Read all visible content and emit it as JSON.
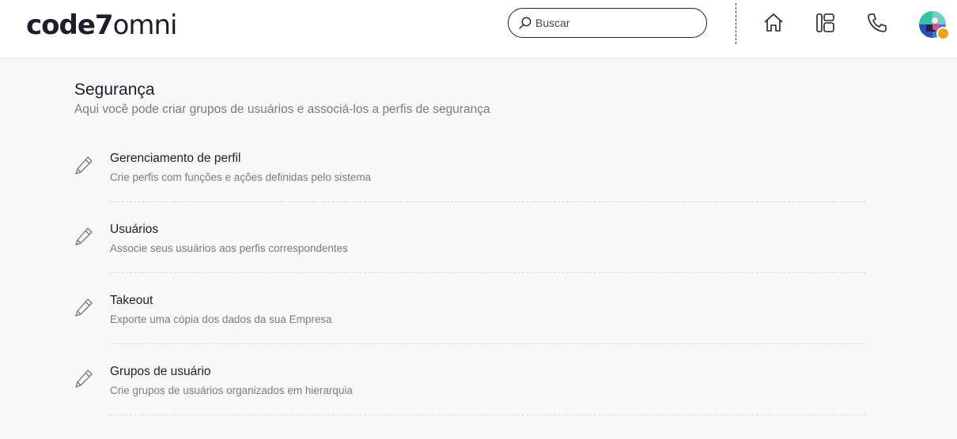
{
  "header": {
    "logo_bold": "code7",
    "logo_light": "omni",
    "search": {
      "placeholder": "Buscar",
      "value": ""
    },
    "nav_icons": [
      "home-icon",
      "dashboard-icon",
      "phone-icon"
    ],
    "status_color": "#f5a01a"
  },
  "page": {
    "title": "Segurança",
    "subtitle": "Aqui você pode criar grupos de usuários e associá-los a perfis de segurança"
  },
  "items": [
    {
      "title": "Gerenciamento de perfil",
      "description": "Crie perfis com funções e ações definidas pelo sistema"
    },
    {
      "title": "Usuários",
      "description": "Associe seus usuários aos perfis correspondentes"
    },
    {
      "title": "Takeout",
      "description": "Exporte uma cópia dos dados da sua Empresa"
    },
    {
      "title": "Grupos de usuário",
      "description": "Crie grupos de usuários organizados em hierarquia"
    }
  ]
}
